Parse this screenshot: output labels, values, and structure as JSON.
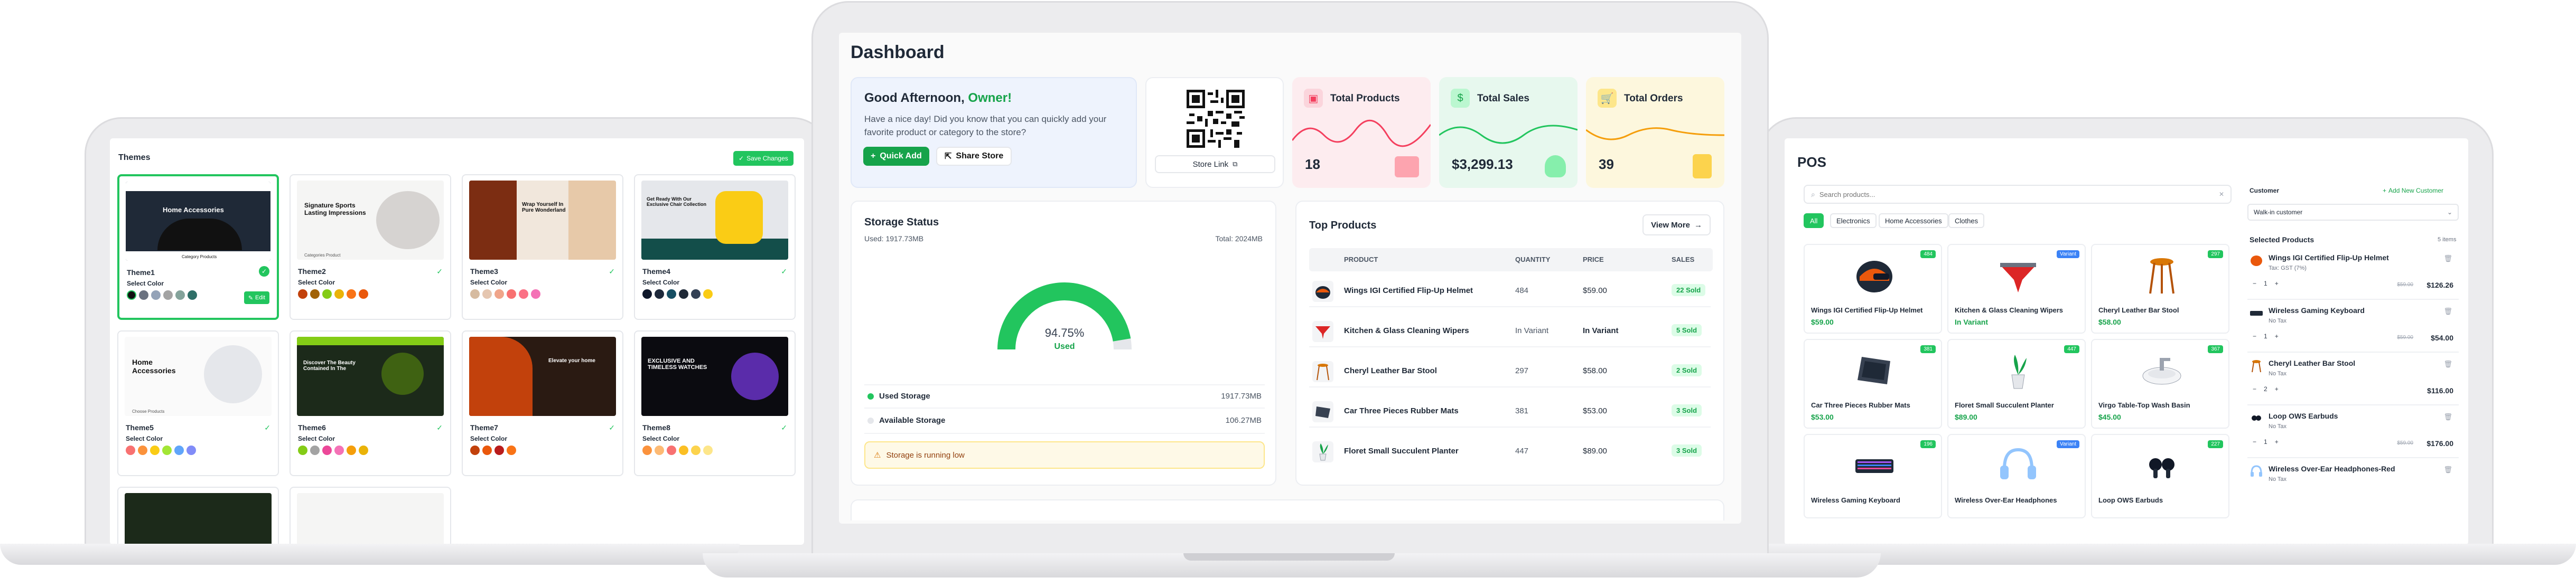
{
  "colors": {
    "green": "#22c55e",
    "green_dark": "#16a34a",
    "blue": "#3b82f6",
    "pink": "#ec4899"
  },
  "themes": {
    "title": "Themes",
    "save_label": "Save Changes",
    "select_color_label": "Select Color",
    "edit_label": "Edit",
    "cards": [
      {
        "name": "Theme1",
        "hero": "Home Accessories",
        "sub": "Category Products",
        "selected": true,
        "colors": [
          "#111111",
          "#6b7280",
          "#94a3b8",
          "#a3a3a3",
          "#84a39b",
          "#2f6f68"
        ]
      },
      {
        "name": "Theme2",
        "hero": "Signature Sports Lasting Impressions",
        "sub": "Categories Product",
        "colors": [
          "#c2410c",
          "#a16207",
          "#84cc16",
          "#eab308",
          "#f97316",
          "#ea580c"
        ]
      },
      {
        "name": "Theme3",
        "hero": "Wrap Yourself In Pure Wonderland",
        "colors": [
          "#d6bba0",
          "#e5c6b0",
          "#f0a58a",
          "#f87171",
          "#fb7185",
          "#f472b6"
        ]
      },
      {
        "name": "Theme4",
        "hero": "Get Ready With Our Exclusive Chair Collection",
        "colors": [
          "#0f172a",
          "#1e293b",
          "#164e63",
          "#1f2937",
          "#334155",
          "#facc15"
        ]
      },
      {
        "name": "Theme5",
        "hero": "Home Accessories",
        "sub": "Choose Products",
        "colors": [
          "#f87171",
          "#fb923c",
          "#facc15",
          "#a3e635",
          "#60a5fa",
          "#818cf8"
        ]
      },
      {
        "name": "Theme6",
        "hero": "Discover The Beauty Contained In The",
        "colors": [
          "#84cc16",
          "#a3a3a3",
          "#ec4899",
          "#f472b6",
          "#f59e0b",
          "#eab308"
        ]
      },
      {
        "name": "Theme7",
        "hero": "Elevate your home",
        "colors": [
          "#c2410c",
          "#ea580c",
          "#b91c1c",
          "#f97316"
        ]
      },
      {
        "name": "Theme8",
        "hero": "EXCLUSIVE AND TIMELESS WATCHES",
        "colors": [
          "#fb923c",
          "#fdba74",
          "#f87171",
          "#fbbf24",
          "#fcd34d",
          "#fde68a"
        ]
      }
    ]
  },
  "dashboard": {
    "title": "Dashboard",
    "greeting": "Good Afternoon,",
    "owner": "Owner!",
    "greeting_text": "Have a nice day! Did you know that you can quickly add your favorite product or category to the store?",
    "quick_add": "Quick Add",
    "share_store": "Share Store",
    "store_link": "Store Link",
    "stats": [
      {
        "title": "Total Products",
        "value": "18",
        "bg": "#fdecef",
        "accent": "#f43f5e",
        "icon_bg": "#f43f5e"
      },
      {
        "title": "Total Sales",
        "value": "$3,299.13",
        "bg": "#e7f8ee",
        "accent": "#22c55e",
        "icon_bg": "#22c55e"
      },
      {
        "title": "Total Orders",
        "value": "39",
        "bg": "#fdf7dd",
        "accent": "#f59e0b",
        "icon_bg": "#f59e0b"
      }
    ],
    "storage": {
      "title": "Storage Status",
      "used": "Used: 1917.73MB",
      "total": "Total: 2024MB",
      "percent_label": "94.75%",
      "percent": 94.75,
      "used_word": "Used",
      "used_storage_label": "Used Storage",
      "used_storage_value": "1917.73MB",
      "available_label": "Available Storage",
      "available_value": "106.27MB",
      "warning": "Storage is running low"
    },
    "top_products": {
      "title": "Top Products",
      "view_more": "View More",
      "headers": [
        "PRODUCT",
        "QUANTITY",
        "PRICE",
        "SALES"
      ],
      "rows": [
        {
          "name": "Wings IGI Certified Flip-Up Helmet",
          "qty": "484",
          "price": "$59.00",
          "sales": "22 Sold"
        },
        {
          "name": "Kitchen & Glass Cleaning Wipers",
          "qty": "In Variant",
          "price": "In Variant",
          "sales": "5 Sold"
        },
        {
          "name": "Cheryl Leather Bar Stool",
          "qty": "297",
          "price": "$58.00",
          "sales": "2 Sold"
        },
        {
          "name": "Car Three Pieces Rubber Mats",
          "qty": "381",
          "price": "$53.00",
          "sales": "3 Sold"
        },
        {
          "name": "Floret Small Succulent Planter",
          "qty": "447",
          "price": "$89.00",
          "sales": "3 Sold"
        }
      ]
    }
  },
  "pos": {
    "title": "POS",
    "search_placeholder": "Search products...",
    "categories": [
      "All",
      "Electronics",
      "Home Accessories",
      "Clothes"
    ],
    "products": [
      {
        "name": "Wings IGI Certified Flip-Up Helmet",
        "price": "$59.00",
        "badge": "484",
        "badge_color": "#22c55e"
      },
      {
        "name": "Kitchen & Glass Cleaning Wipers",
        "price": "In Variant",
        "badge": "Variant",
        "badge_color": "#3b82f6"
      },
      {
        "name": "Cheryl Leather Bar Stool",
        "price": "$58.00",
        "badge": "297",
        "badge_color": "#22c55e"
      },
      {
        "name": "Car Three Pieces Rubber Mats",
        "price": "$53.00",
        "badge": "381",
        "badge_color": "#22c55e"
      },
      {
        "name": "Floret Small Succulent Planter",
        "price": "$89.00",
        "badge": "447",
        "badge_color": "#22c55e"
      },
      {
        "name": "Virgo Table-Top Wash Basin",
        "price": "$45.00",
        "badge": "367",
        "badge_color": "#22c55e"
      },
      {
        "name": "Wireless Gaming Keyboard",
        "price": "",
        "badge": "196",
        "badge_color": "#22c55e"
      },
      {
        "name": "Wireless Over-Ear Headphones",
        "price": "",
        "badge": "Variant",
        "badge_color": "#3b82f6"
      },
      {
        "name": "Loop OWS Earbuds",
        "price": "",
        "badge": "227",
        "badge_color": "#22c55e"
      }
    ],
    "customer_label": "Customer",
    "add_customer": "Add New Customer",
    "customer_value": "Walk-in customer",
    "selected_label": "Selected Products",
    "selected_count": "5 items",
    "selected": [
      {
        "name": "Wings IGI Certified Flip-Up Helmet",
        "sub": "Tax: GST (7%)",
        "qty": "1",
        "old": "$59.00",
        "price": "$126.26"
      },
      {
        "name": "Wireless Gaming Keyboard",
        "sub": "No Tax",
        "qty": "1",
        "old": "$59.00",
        "price": "$54.00"
      },
      {
        "name": "Cheryl Leather Bar Stool",
        "sub": "No Tax",
        "qty": "2",
        "old": "",
        "price": "$116.00"
      },
      {
        "name": "Loop OWS Earbuds",
        "sub": "No Tax",
        "qty": "1",
        "old": "$59.00",
        "price": "$176.00"
      },
      {
        "name": "Wireless Over-Ear Headphones-Red",
        "sub": "No Tax",
        "qty": "",
        "old": "",
        "price": ""
      }
    ]
  }
}
